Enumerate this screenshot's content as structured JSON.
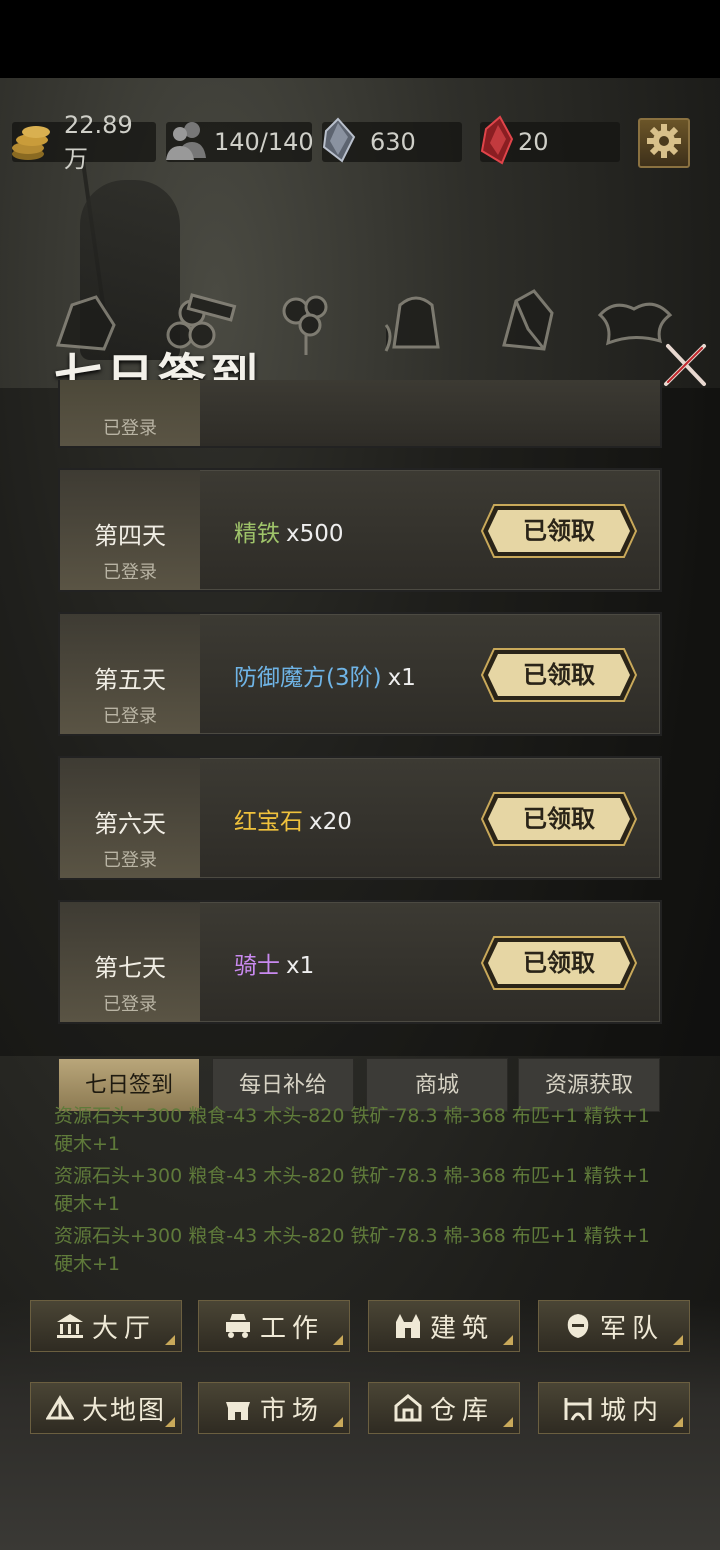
{
  "resources": {
    "gold": "22.89万",
    "population": "140/140",
    "crystal": "630",
    "ruby": "20"
  },
  "category_labels": [
    "棉花",
    "粮食",
    "铁矿",
    "皮"
  ],
  "panel": {
    "title": "七日签到",
    "partial_status": "已登录",
    "days": [
      {
        "name": "第四天",
        "status": "已登录",
        "item": "精铁",
        "qty": "x500",
        "item_color": "#9fc46a",
        "button": "已领取"
      },
      {
        "name": "第五天",
        "status": "已登录",
        "item": "防御魔方(3阶)",
        "qty": "x1",
        "item_color": "#6fb4e6",
        "button": "已领取"
      },
      {
        "name": "第六天",
        "status": "已登录",
        "item": "红宝石",
        "qty": "x20",
        "item_color": "#f0c23c",
        "button": "已领取"
      },
      {
        "name": "第七天",
        "status": "已登录",
        "item": "骑士",
        "qty": "x1",
        "item_color": "#c98af0",
        "button": "已领取"
      }
    ]
  },
  "tabs": [
    "七日签到",
    "每日补给",
    "商城",
    "资源获取"
  ],
  "log": [
    "资源石头+300 粮食-43 木头-820 铁矿-78.3 棉-368 布匹+1 精铁+1 硬木+1",
    "资源石头+300 粮食-43 木头-820 铁矿-78.3 棉-368 布匹+1 精铁+1 硬木+1",
    "资源石头+300 粮食-43 木头-820 铁矿-78.3 棉-368 布匹+1 精铁+1 硬木+1"
  ],
  "nav": [
    {
      "label": "大厅",
      "icon": "hall-icon"
    },
    {
      "label": "工作",
      "icon": "work-icon"
    },
    {
      "label": "建筑",
      "icon": "building-icon"
    },
    {
      "label": "军队",
      "icon": "army-icon"
    },
    {
      "label": "大地图",
      "icon": "map-icon"
    },
    {
      "label": "市场",
      "icon": "market-icon"
    },
    {
      "label": "仓库",
      "icon": "warehouse-icon"
    },
    {
      "label": "城内",
      "icon": "city-icon"
    }
  ],
  "colors": {
    "accent_gold": "#c9a95a",
    "log_green": "#5f7a3a"
  }
}
